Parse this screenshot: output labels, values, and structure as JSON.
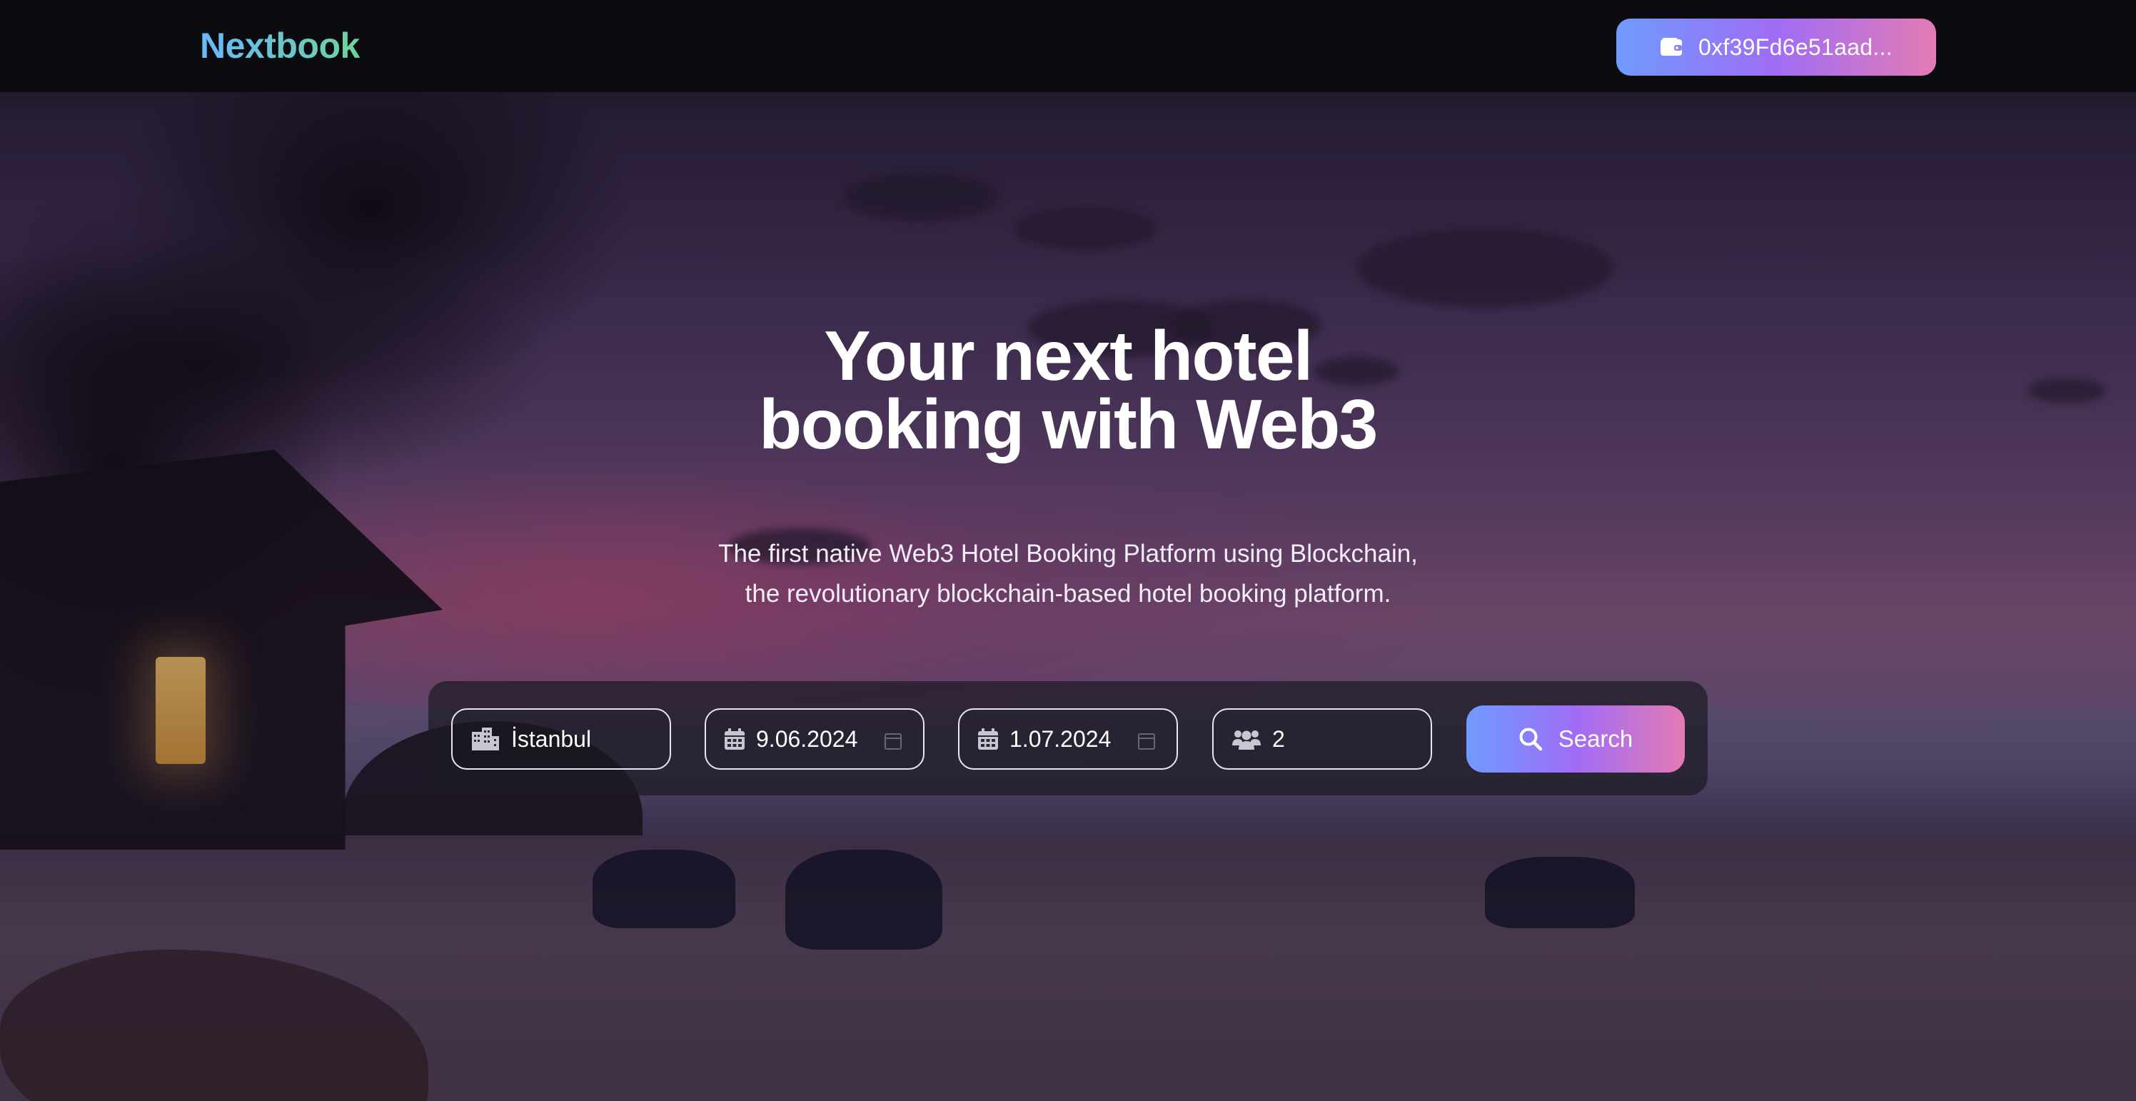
{
  "navbar": {
    "brand": "Nextbook",
    "wallet": {
      "icon": "wallet-icon",
      "address": "0xf39Fd6e51aad..."
    }
  },
  "hero": {
    "headline": [
      "Your next hotel",
      "booking with Web3"
    ],
    "subtitle": [
      "The first native Web3 Hotel Booking Platform using Blockchain,",
      "the revolutionary blockchain-based hotel booking platform."
    ]
  },
  "search": {
    "location": {
      "icon": "city-icon",
      "value": "İstanbul"
    },
    "check_in": {
      "icon": "calendar-icon",
      "value": "9.06.2024",
      "visible_text": "9.06.2024"
    },
    "check_out": {
      "icon": "calendar-icon",
      "value": "1.07.2024"
    },
    "guests": {
      "icon": "users-icon",
      "value": "2"
    },
    "button": {
      "icon": "search-icon",
      "label": "Search"
    }
  },
  "colors": {
    "accent_gradient": [
      "#6f9bff",
      "#a06cf6",
      "#e47bb3"
    ],
    "brand_gradient": [
      "#67b8ff",
      "#6fd39b"
    ],
    "navbar_bg": "#0c0c10"
  }
}
